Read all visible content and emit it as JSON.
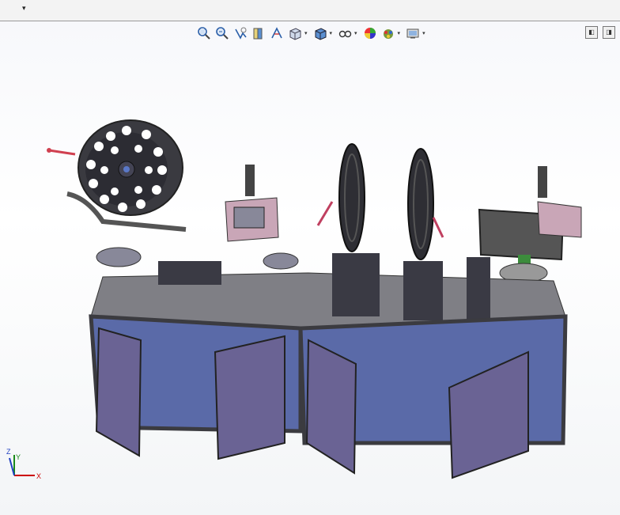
{
  "menu": {
    "dropdown_glyph": "▾"
  },
  "heads_up_toolbar": {
    "buttons": [
      {
        "name": "zoom-to-fit-icon",
        "dropdown": false
      },
      {
        "name": "zoom-to-area-icon",
        "dropdown": false
      },
      {
        "name": "previous-view-icon",
        "dropdown": false
      },
      {
        "name": "section-view-icon",
        "dropdown": false
      },
      {
        "name": "dynamic-annotation-icon",
        "dropdown": false
      },
      {
        "name": "view-orientation-icon",
        "dropdown": true
      },
      {
        "name": "display-style-icon",
        "dropdown": true
      },
      {
        "name": "hide-show-items-icon",
        "dropdown": true
      },
      {
        "name": "edit-appearance-icon",
        "dropdown": false
      },
      {
        "name": "apply-scene-icon",
        "dropdown": true
      },
      {
        "name": "view-settings-icon",
        "dropdown": true
      }
    ],
    "dropdown_glyph": "▾"
  },
  "window_controls": {
    "tile_left": "◧",
    "tile_right": "◨"
  },
  "triad": {
    "x_label": "X",
    "y_label": "Y",
    "z_label": "Z"
  },
  "colors": {
    "frame": "#6b6b70",
    "panel": "#5a6aa8",
    "door": "#6a6394",
    "table": "#7f7f85",
    "accent_green": "#3c8c3c"
  }
}
